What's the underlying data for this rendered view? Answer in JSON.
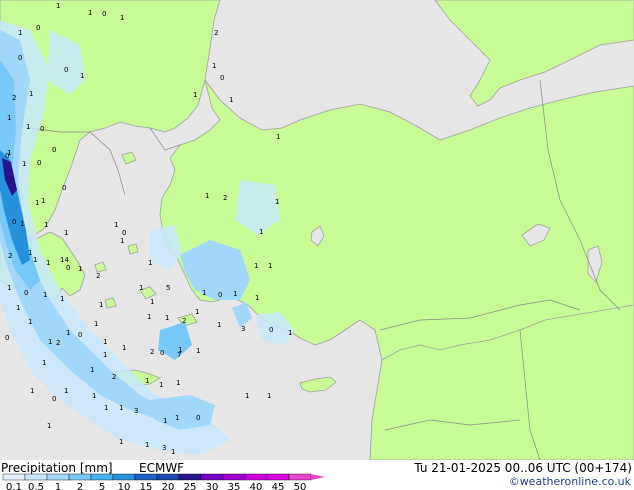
{
  "map": {
    "colors": {
      "sea": "#e6e6e6",
      "land": "#c8fa96",
      "coast": "#a0a0a0",
      "border": "#8a8a8a"
    },
    "precip_values": [
      "1",
      "1",
      "0",
      "1",
      "0",
      "1",
      "2",
      "0",
      "0",
      "1",
      "1",
      "1",
      "1",
      "1",
      "2",
      "1",
      "0",
      "0",
      "0",
      "1",
      "0",
      "1",
      "0",
      "1",
      "1",
      "1",
      "2",
      "1",
      "0",
      "1",
      "1",
      "1",
      "1",
      "0",
      "1",
      "1",
      "2",
      "1",
      "0",
      "1",
      "1",
      "2",
      "1",
      "1",
      "1",
      "0",
      "1",
      "1",
      "1",
      "5",
      "1",
      "1",
      "0",
      "1",
      "1",
      "1",
      "1",
      "1",
      "2",
      "1",
      "1",
      "0",
      "1",
      "1",
      "3",
      "1",
      "1",
      "1",
      "0",
      "1",
      "1",
      "1",
      "1",
      "2",
      "0",
      "1",
      "7",
      "1",
      "2",
      "1",
      "1",
      "1",
      "1",
      "1",
      "1",
      "1",
      "1",
      "3",
      "1",
      "1",
      "1",
      "0",
      "1",
      "1",
      "3",
      "1",
      "1",
      "0",
      "1",
      "1",
      "0",
      "1",
      "2",
      "1",
      "1",
      "0",
      "1",
      "1",
      "14",
      "1"
    ]
  },
  "footer": {
    "title": "Precipitation [mm]",
    "model": "ECMWF",
    "valid": "Tu 21-01-2025 00..06 UTC (00+174)",
    "credit": "©weatheronline.co.uk",
    "legend_labels": [
      "0.1",
      "0.5",
      "1",
      "2",
      "5",
      "10",
      "15",
      "20",
      "25",
      "30",
      "35",
      "40",
      "45",
      "50"
    ],
    "legend_colors": [
      "#e6f0fa",
      "#c8e6fa",
      "#a0d7fa",
      "#78c8fa",
      "#46b4f0",
      "#2891dc",
      "#1e64c8",
      "#1e46aa",
      "#28148c",
      "#7800c8",
      "#a000d2",
      "#c800dc",
      "#dc00e6",
      "#e646c8"
    ]
  }
}
